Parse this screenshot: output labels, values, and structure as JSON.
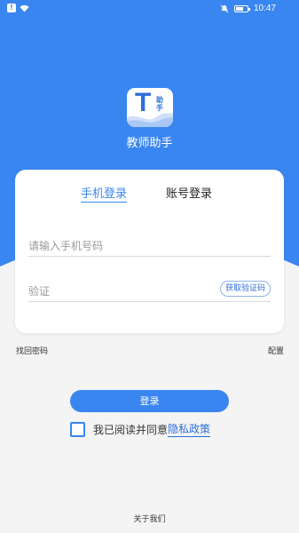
{
  "status_bar": {
    "time": "10:47",
    "alert_icon": "alert-icon",
    "wifi_icon": "wifi-icon",
    "silent_icon": "bell-off-icon",
    "battery_icon": "battery-icon",
    "battery_level": 0.7
  },
  "app": {
    "logo_letter": "T",
    "logo_sub": "助手",
    "name": "教师助手"
  },
  "tabs": {
    "phone": "手机登录",
    "account": "账号登录"
  },
  "form": {
    "phone_placeholder": "请输入手机号码",
    "code_placeholder": "验证",
    "get_code": "获取验证码"
  },
  "links": {
    "forgot_password": "找回密码",
    "config": "配置",
    "about": "关于我们"
  },
  "login_button": "登录",
  "agreement": {
    "text": "我已阅读并同意",
    "policy": "隐私政策"
  },
  "colors": {
    "primary": "#3a86f0",
    "link": "#2e6fd8",
    "background": "#f4f4f4"
  }
}
